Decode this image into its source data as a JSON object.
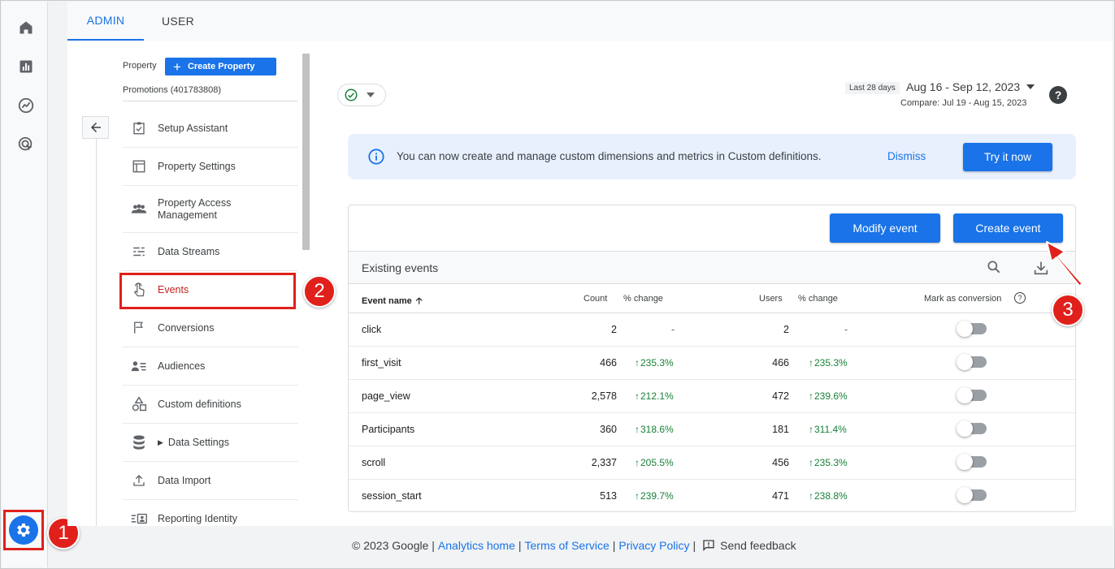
{
  "tabs": [
    {
      "label": "ADMIN"
    },
    {
      "label": "USER"
    }
  ],
  "property": {
    "label": "Property",
    "create_button": "Create Property",
    "name": "Promotions (401783808)"
  },
  "nav": {
    "items": [
      {
        "label": "Setup Assistant"
      },
      {
        "label": "Property Settings"
      },
      {
        "label": "Property Access Management"
      },
      {
        "label": "Data Streams"
      },
      {
        "label": "Events"
      },
      {
        "label": "Conversions"
      },
      {
        "label": "Audiences"
      },
      {
        "label": "Custom definitions"
      },
      {
        "label": "Data Settings"
      },
      {
        "label": "Data Import"
      },
      {
        "label": "Reporting Identity"
      }
    ]
  },
  "date": {
    "chip": "Last 28 days",
    "range": "Aug 16 - Sep 12, 2023",
    "compare": "Compare: Jul 19 - Aug 15, 2023"
  },
  "banner": {
    "message": "You can now create and manage custom dimensions and metrics in Custom definitions.",
    "dismiss": "Dismiss",
    "try_now": "Try it now"
  },
  "events": {
    "modify_button": "Modify event",
    "create_button": "Create event",
    "title": "Existing events",
    "columns": {
      "name": "Event name",
      "count": "Count",
      "count_change": "% change",
      "users": "Users",
      "users_change": "% change",
      "conversion": "Mark as conversion"
    },
    "rows": [
      {
        "name": "click",
        "count": "2",
        "count_change": "-",
        "users": "2",
        "users_change": "-"
      },
      {
        "name": "first_visit",
        "count": "466",
        "count_change": "235.3%",
        "users": "466",
        "users_change": "235.3%"
      },
      {
        "name": "page_view",
        "count": "2,578",
        "count_change": "212.1%",
        "users": "472",
        "users_change": "239.6%"
      },
      {
        "name": "Participants",
        "count": "360",
        "count_change": "318.6%",
        "users": "181",
        "users_change": "311.4%"
      },
      {
        "name": "scroll",
        "count": "2,337",
        "count_change": "205.5%",
        "users": "456",
        "users_change": "235.3%"
      },
      {
        "name": "session_start",
        "count": "513",
        "count_change": "239.7%",
        "users": "471",
        "users_change": "238.8%"
      }
    ]
  },
  "footer": {
    "copyright": "© 2023 Google |",
    "analytics_home": "Analytics home",
    "terms": "Terms of Service",
    "privacy": "Privacy Policy",
    "feedback": "Send feedback"
  },
  "annotations": {
    "one": "1",
    "two": "2",
    "three": "3"
  },
  "colors": {
    "accent": "#1a73e8",
    "highlight": "#e0201b",
    "positive": "#188038"
  }
}
